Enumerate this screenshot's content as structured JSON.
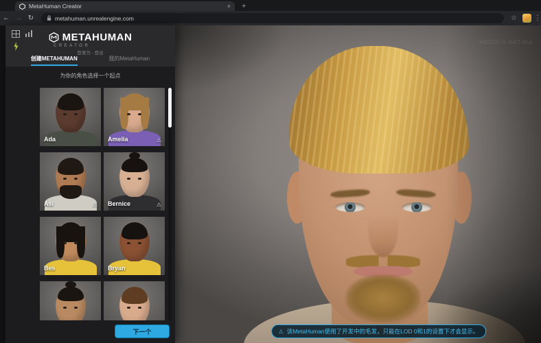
{
  "browser": {
    "tab_title": "MetaHuman Creator",
    "url": "metahuman.unrealengine.com"
  },
  "icons": {
    "back": "←",
    "forward": "→",
    "reload": "↻",
    "star": "☆",
    "menu": "⋮",
    "close": "×",
    "new_tab": "+",
    "warning": "⚠"
  },
  "header": {
    "logo": "METAHUMAN",
    "logo_sub": "CREATOR",
    "signin": "登录为 · 登出",
    "tabs": [
      {
        "label": "创建METAHUMAN",
        "active": true
      },
      {
        "label": "我的MetaHuman",
        "active": false
      }
    ]
  },
  "panel": {
    "caption": "为你的角色选择一个起点",
    "next_label": "下一个"
  },
  "characters": [
    {
      "name": "Ada",
      "warning": false,
      "hair_style": "short",
      "skin": "#5b3b2e",
      "hair": "#1b1512",
      "top": "#4a4f46"
    },
    {
      "name": "Amelia",
      "warning": true,
      "hair_style": "long",
      "skin": "#d8a98c",
      "hair": "#a57b43",
      "top": "#7a5fb5"
    },
    {
      "name": "Asi",
      "warning": true,
      "hair_style": "beard",
      "skin": "#b07a52",
      "hair": "#201812",
      "top": "#cfccc4"
    },
    {
      "name": "Bernice",
      "warning": true,
      "hair_style": "updo",
      "skin": "#d7b093",
      "hair": "#17120f",
      "top": "#2e2e30"
    },
    {
      "name": "Bes",
      "warning": false,
      "hair_style": "shag",
      "skin": "#c08a5c",
      "hair": "#191310",
      "top": "#e6c23b"
    },
    {
      "name": "Bryan",
      "warning": false,
      "hair_style": "short",
      "skin": "#8a5133",
      "hair": "#161210",
      "top": "#e6c23b"
    },
    {
      "name": "",
      "warning": false,
      "hair_style": "updo",
      "skin": "#b98a62",
      "hair": "#1a1511",
      "top": "#6b6b6d"
    },
    {
      "name": "",
      "warning": false,
      "hair_style": "short",
      "skin": "#d9ab8d",
      "hair": "#5e3d22",
      "top": "#8a8a8c"
    }
  ],
  "viewport": {
    "notification": "该MetaHuman使用了开发中的毛发，只能在LOD 0和1的设置下才会显示。",
    "watermark": "e922357e-8af7-8ca"
  },
  "theme": {
    "accent": "#2fa9e2",
    "panel-bg": "#1c1c1f",
    "header-bg": "#2a2a2d",
    "hero-skin": "#c2916f",
    "hero-skin-light": "#d4a686",
    "hero-hair": "#c79a43"
  }
}
